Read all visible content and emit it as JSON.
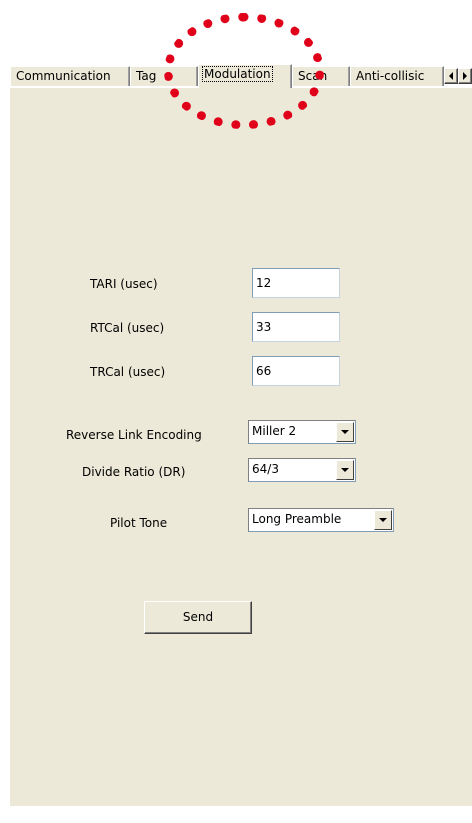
{
  "tabs": [
    {
      "label": "Communication",
      "active": false
    },
    {
      "label": "Tag",
      "active": false
    },
    {
      "label": "Modulation",
      "active": true
    },
    {
      "label": "Scan",
      "active": false
    },
    {
      "label": "Anti-collisic",
      "active": false
    }
  ],
  "scroll_buttons": {
    "left_icon": "scroll-left-icon",
    "right_icon": "scroll-right-icon"
  },
  "fields": {
    "tari": {
      "label": "TARI (usec)",
      "value": "12"
    },
    "rtcal": {
      "label": "RTCal (usec)",
      "value": "33"
    },
    "trcal": {
      "label": "TRCal (usec)",
      "value": "66"
    }
  },
  "selects": {
    "reverse_link": {
      "label": "Reverse Link Encoding",
      "value": "Miller 2"
    },
    "divide_ratio": {
      "label": "Divide Ratio (DR)",
      "value": "64/3"
    },
    "pilot_tone": {
      "label": "Pilot Tone",
      "value": "Long Preamble"
    }
  },
  "send_label": "Send",
  "colors": {
    "panel": "#ece9d8",
    "annotation": "#e0001a"
  }
}
